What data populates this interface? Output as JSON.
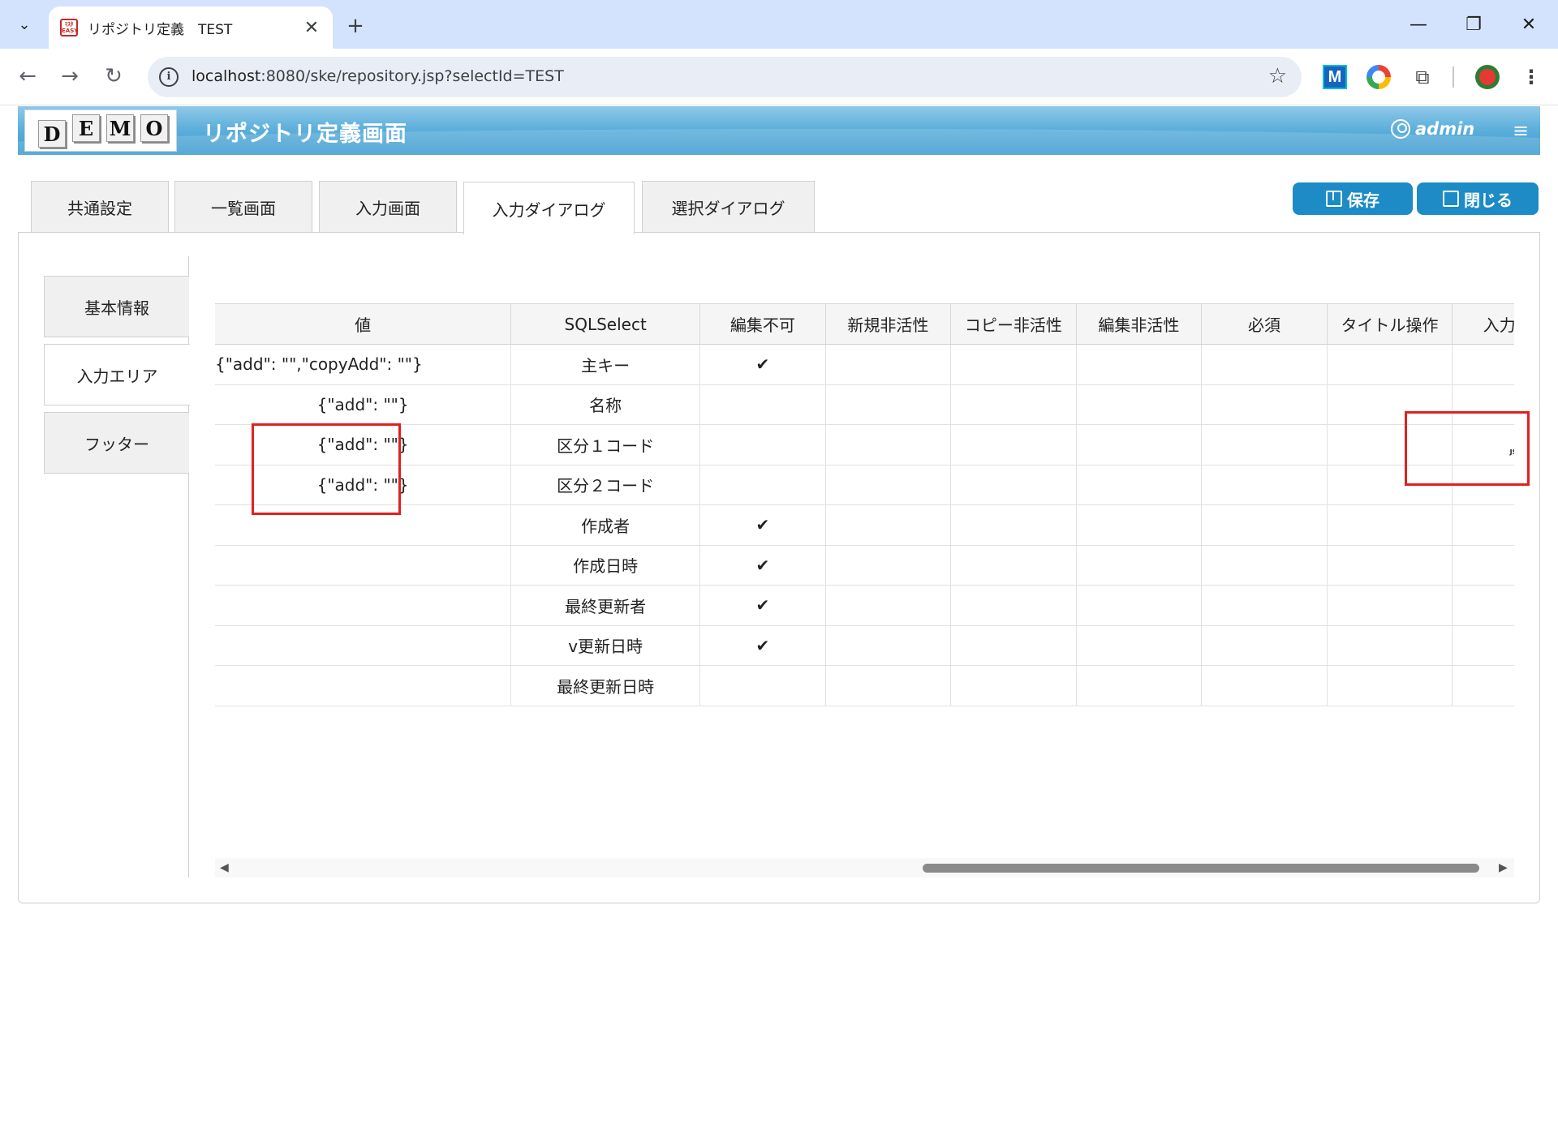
{
  "browser": {
    "tab_title": "リポジトリ定義　TEST",
    "favicon_text": "ﾏｽﾀ EASY",
    "url_host": "localhost",
    "url_rest": ":8080/ske/repository.jsp?selectId=TEST",
    "ext_m_label": "M"
  },
  "app": {
    "logo_letters": [
      "D",
      "E",
      "M",
      "O"
    ],
    "title": "リポジトリ定義画面",
    "user": "admin"
  },
  "top_tabs": [
    "共通設定",
    "一覧画面",
    "入力画面",
    "入力ダイアログ",
    "選択ダイアログ"
  ],
  "active_top_tab": "入力ダイアログ",
  "buttons": {
    "save": "保存",
    "close": "閉じる"
  },
  "side_tabs": [
    "基本情報",
    "入力エリア",
    "フッター"
  ],
  "active_side_tab": "入力エリア",
  "grid": {
    "columns": [
      "値",
      "SQLSelect",
      "編集不可",
      "新規非活性",
      "コピー非活性",
      "編集非活性",
      "必須",
      "タイトル操作",
      "入力枠操作"
    ],
    "rows": [
      {
        "value": "{\"add\": \"\",\"copyAdd\": \"\"}",
        "sql": "主キー",
        "edit_disabled": true,
        "input_op": ""
      },
      {
        "value": "{\"add\": \"\"}",
        "sql": "名称",
        "edit_disabled": false,
        "input_op": ""
      },
      {
        "value": "{\"add\": \"\"}",
        "sql": "区分１コード",
        "edit_disabled": false,
        "input_op": "js-file-icon"
      },
      {
        "value": "{\"add\": \"\"}",
        "sql": "区分２コード",
        "edit_disabled": false,
        "input_op": ""
      },
      {
        "value": "",
        "sql": "作成者",
        "edit_disabled": true,
        "input_op": ""
      },
      {
        "value": "",
        "sql": "作成日時",
        "edit_disabled": true,
        "input_op": ""
      },
      {
        "value": "",
        "sql": "最終更新者",
        "edit_disabled": true,
        "input_op": ""
      },
      {
        "value": "",
        "sql": "v更新日時",
        "edit_disabled": true,
        "input_op": ""
      },
      {
        "value": "",
        "sql": "最終更新日時",
        "edit_disabled": false,
        "input_op": ""
      }
    ],
    "check_glyph": "✔"
  },
  "colors": {
    "accent": "#1c8bc6",
    "highlight": "#e02020"
  }
}
